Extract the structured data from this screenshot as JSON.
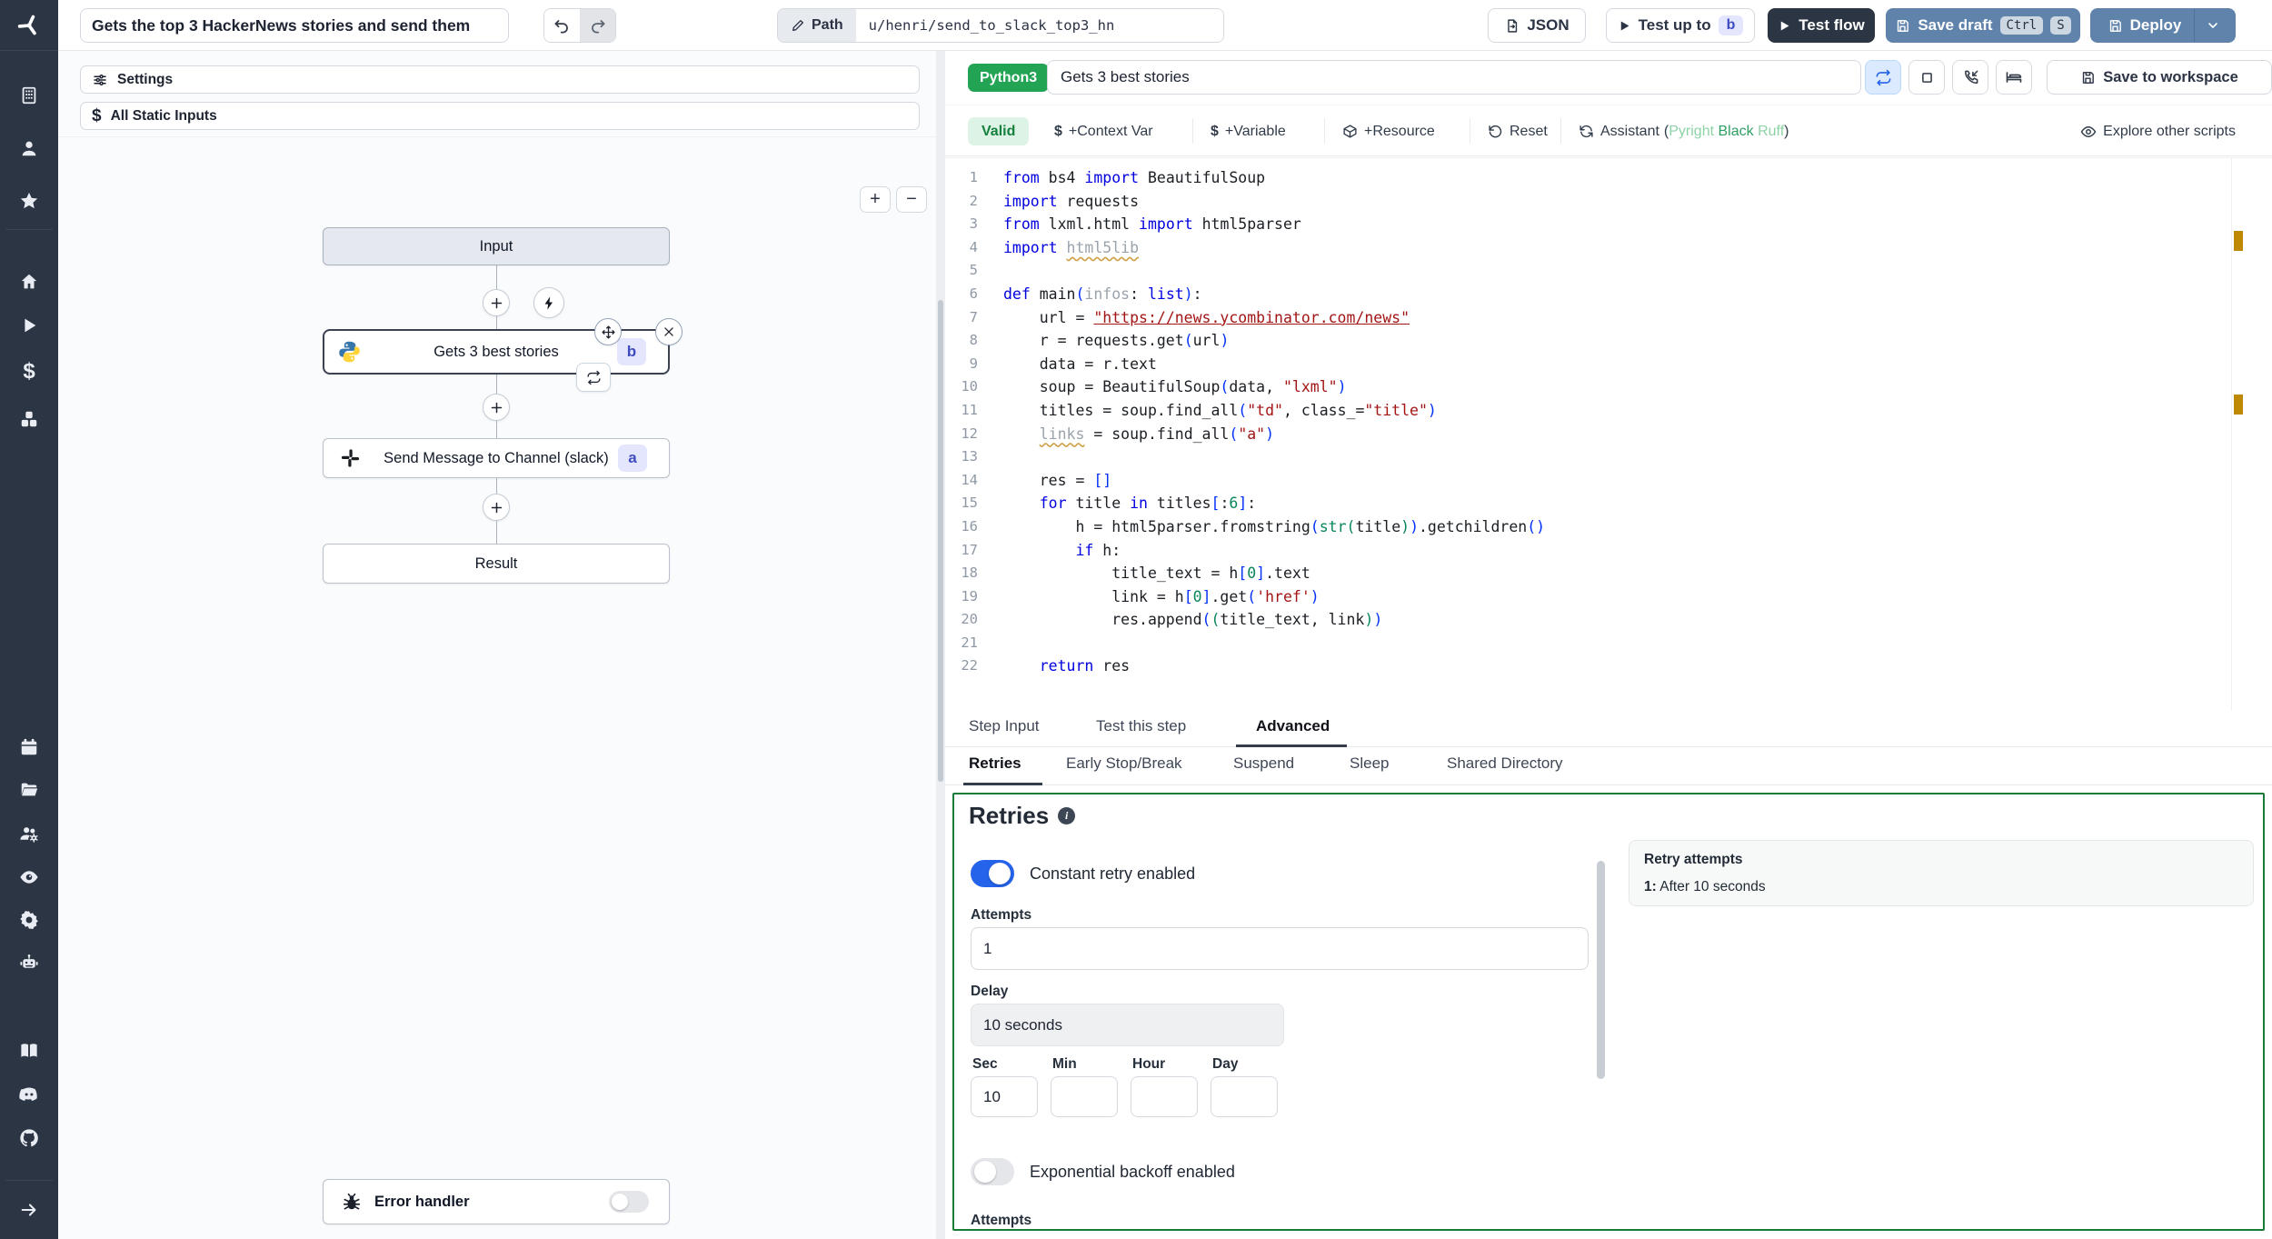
{
  "topbar": {
    "title": "Gets the top 3 HackerNews stories and send them",
    "path_label": "Path",
    "path_value": "u/henri/send_to_slack_top3_hn",
    "json_label": "JSON",
    "test_up_to_label": "Test up to",
    "test_up_to_badge": "b",
    "test_flow_label": "Test flow",
    "save_draft_label": "Save draft",
    "kbd_ctrl": "Ctrl",
    "kbd_s": "S",
    "deploy_label": "Deploy"
  },
  "sidebar": {
    "icons": [
      "windmill-logo",
      "workspace",
      "user",
      "favorites",
      "home",
      "runs",
      "variables",
      "resources",
      "schedules",
      "folders",
      "groups",
      "audit-logs",
      "settings",
      "workers",
      "docs",
      "discord",
      "github",
      "collapse-sidebar"
    ]
  },
  "canvas": {
    "settings_label": "Settings",
    "static_inputs_label": "All Static Inputs",
    "zoom_in": "+",
    "zoom_out": "−",
    "input_node": "Input",
    "step_b_label": "Gets 3 best stories",
    "step_b_badge": "b",
    "step_a_label": "Send Message to Channel (slack)",
    "step_a_badge": "a",
    "result_node": "Result",
    "error_handler_label": "Error handler"
  },
  "script_header": {
    "language": "Python3",
    "name": "Gets 3 best stories",
    "save_to_workspace": "Save to workspace",
    "valid": "Valid",
    "add_context_var": "+Context Var",
    "add_variable": "+Variable",
    "add_resource": "+Resource",
    "reset": "Reset",
    "assistant_label": "Assistant",
    "assistant_open_paren": "(",
    "assistant_close_paren": ")",
    "assistant_tools": [
      "Pyright",
      "Black",
      "Ruff"
    ],
    "explore": "Explore other scripts"
  },
  "code": {
    "lines": [
      "from bs4 import BeautifulSoup",
      "import requests",
      "from lxml.html import html5parser",
      "import html5lib",
      "",
      "def main(infos: list):",
      "    url = \"https://news.ycombinator.com/news\"",
      "    r = requests.get(url)",
      "    data = r.text",
      "    soup = BeautifulSoup(data, \"lxml\")",
      "    titles = soup.find_all(\"td\", class_=\"title\")",
      "    links = soup.find_all(\"a\")",
      "",
      "    res = []",
      "    for title in titles[:6]:",
      "        h = html5parser.fromstring(str(title)).getchildren()",
      "        if h:",
      "            title_text = h[0].text",
      "            link = h[0].get('href')",
      "            res.append((title_text, link))",
      "",
      "    return res"
    ]
  },
  "tabs": {
    "main": [
      "Step Input",
      "Test this step",
      "Advanced"
    ],
    "main_active": "Advanced",
    "sub": [
      "Retries",
      "Early Stop/Break",
      "Suspend",
      "Sleep",
      "Shared Directory"
    ],
    "sub_active": "Retries"
  },
  "retries": {
    "heading": "Retries",
    "constant_toggle_label": "Constant retry enabled",
    "attempts_label": "Attempts",
    "attempts_value": "1",
    "delay_label": "Delay",
    "delay_value": "10 seconds",
    "sec_label": "Sec",
    "sec_value": "10",
    "min_label": "Min",
    "hour_label": "Hour",
    "day_label": "Day",
    "exponential_toggle_label": "Exponential backoff enabled",
    "attempts2_label": "Attempts",
    "summary_title": "Retry attempts",
    "summary_item_index": "1:",
    "summary_item_text": "After 10 seconds"
  },
  "colors": {
    "sidebar_bg": "#2c3543",
    "steel_blue": "#5f83aa",
    "dark_navy": "#2c3543",
    "accent_blue": "#2563eb",
    "python_green": "#23a455",
    "panel_green_border": "#187a37",
    "warning_marker": "#bf8803",
    "badge_indigo_bg": "#e3e6fd",
    "badge_indigo_text": "#3f4cc0"
  }
}
